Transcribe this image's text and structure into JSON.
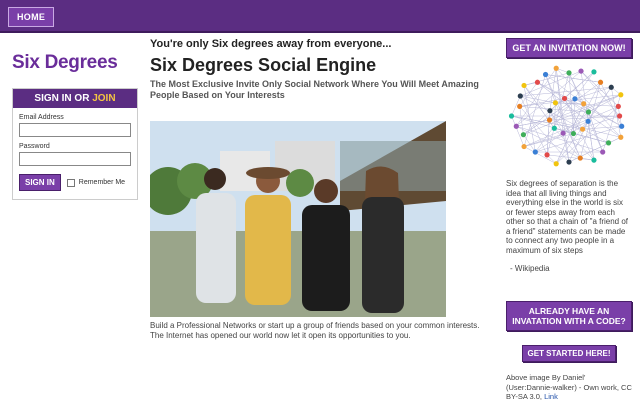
{
  "nav": {
    "home_label": "HOME"
  },
  "left": {
    "logo": "Six Degrees",
    "signin_label": "SIGN IN OR ",
    "join_label": "JOIN",
    "email_label": "Email Address",
    "password_label": "Password",
    "signin_button": "SIGN IN",
    "remember_label": "Remember Me"
  },
  "main": {
    "tagline": "You're only Six degrees away from everyone...",
    "title": "Six Degrees Social Engine",
    "subtitle": "The Most Exclusive Invite Only Social Network Where You Will Meet Amazing People Based on Your Interests",
    "description": "Build a Professional Networks or start up a group of friends based on your common interests. The Internet has opened our world now let it open its opportunities to you."
  },
  "right": {
    "invite_button": "GET AN INVITATION NOW!",
    "quote": "Six degrees of separation is the idea that all living things and everything else in the world is six or fewer steps away from each other so that a chain of \"a friend of a friend\" statements can be made to connect any two people in a maximum of six steps",
    "quote_source": "- Wikipedia",
    "code_button": "ALREADY HAVE AN INVATATION WITH A CODE?",
    "started_button": "GET STARTED HERE!",
    "credit_text": "Above image By Daniel' (User:Dannie-walker) - Own work, CC BY-SA 3.0, ",
    "credit_link": "Link"
  },
  "colors": {
    "brand_purple": "#5b2d82",
    "button_purple": "#7a3fa8",
    "logo_purple": "#6a2d9a",
    "join_yellow": "#f4c542"
  }
}
